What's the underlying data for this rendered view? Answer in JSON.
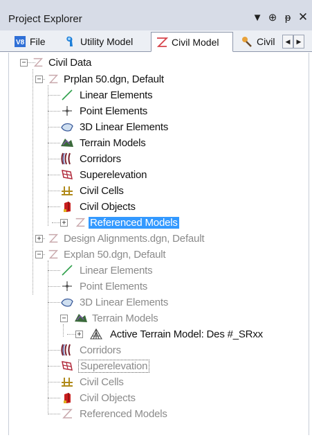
{
  "window": {
    "title": "Project Explorer",
    "controls": {
      "dropdown": "▼",
      "pin": "⊕",
      "autohide": "ᵽ",
      "close": "✕"
    }
  },
  "tabs": [
    {
      "label": "File",
      "icon": "file-icon",
      "active": false
    },
    {
      "label": "Utility Model",
      "icon": "utility-model-icon",
      "active": false
    },
    {
      "label": "Civil Model",
      "icon": "civil-model-icon",
      "active": true
    },
    {
      "label": "Civil",
      "icon": "civil-icon",
      "active": false
    }
  ],
  "tab_scroll": {
    "left": "◀",
    "right": "▶"
  },
  "tree": {
    "root": {
      "label": "Civil Data"
    },
    "models": [
      {
        "label": "Prplan 50.dgn, Default",
        "children": [
          {
            "label": "Linear Elements"
          },
          {
            "label": "Point Elements"
          },
          {
            "label": "3D Linear Elements"
          },
          {
            "label": "Terrain Models"
          },
          {
            "label": "Corridors"
          },
          {
            "label": "Superelevation"
          },
          {
            "label": "Civil Cells"
          },
          {
            "label": "Civil Objects"
          },
          {
            "label": "Referenced Models",
            "state": "selected"
          }
        ]
      },
      {
        "label": "Design Alignments.dgn, Default"
      },
      {
        "label": "Explan 50.dgn, Default",
        "children": [
          {
            "label": "Linear Elements"
          },
          {
            "label": "Point Elements"
          },
          {
            "label": "3D Linear Elements"
          },
          {
            "label": "Terrain Models",
            "children": [
              {
                "label": "Active Terrain Model: Des #_SRxx"
              }
            ]
          },
          {
            "label": "Corridors"
          },
          {
            "label": "Superelevation",
            "state": "focused"
          },
          {
            "label": "Civil Cells"
          },
          {
            "label": "Civil Objects"
          },
          {
            "label": "Referenced Models"
          }
        ]
      }
    ]
  },
  "colors": {
    "selection": "#3399ff",
    "disabled_text": "#8a8a8a",
    "title_bar": "#d7dce7"
  }
}
